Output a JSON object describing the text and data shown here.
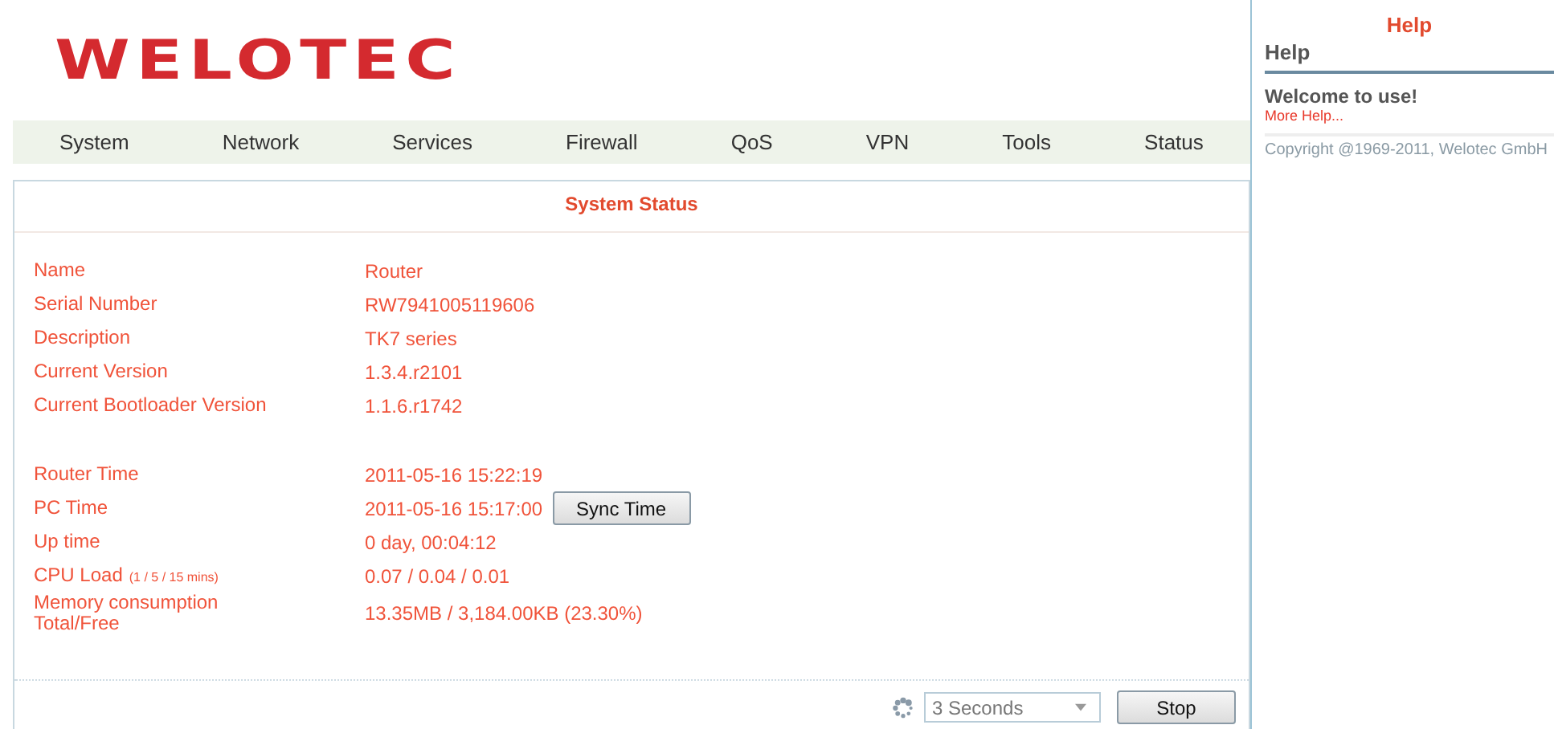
{
  "logo": {
    "text": "WELOTEC"
  },
  "nav": [
    {
      "label": "System"
    },
    {
      "label": "Network"
    },
    {
      "label": "Services"
    },
    {
      "label": "Firewall"
    },
    {
      "label": "QoS"
    },
    {
      "label": "VPN"
    },
    {
      "label": "Tools"
    },
    {
      "label": "Status"
    }
  ],
  "panel": {
    "title": "System Status",
    "rows": [
      {
        "kind": "info",
        "label": "Name",
        "value": "Router"
      },
      {
        "kind": "info",
        "label": "Serial Number",
        "value": "RW7941005119606"
      },
      {
        "kind": "info",
        "label": "Description",
        "value": "TK7 series"
      },
      {
        "kind": "info",
        "label": "Current Version",
        "value": "1.3.4.r2101"
      },
      {
        "kind": "info",
        "label": "Current Bootloader Version",
        "value": "1.1.6.r1742"
      },
      {
        "kind": "gap"
      },
      {
        "kind": "info",
        "label": "Router Time",
        "value": "2011-05-16 15:22:19"
      },
      {
        "kind": "button",
        "label": "PC Time",
        "value": "2011-05-16 15:17:00",
        "button": "Sync Time"
      },
      {
        "kind": "info",
        "label": "Up time",
        "value": "0 day, 00:04:12"
      },
      {
        "kind": "info",
        "label": "CPU Load",
        "note": "(1 / 5 / 15 mins)",
        "value": "0.07 / 0.04 / 0.01"
      },
      {
        "kind": "info",
        "label": "Memory consumption\nTotal/Free",
        "value": "13.35MB / 3,184.00KB (23.30%)"
      }
    ],
    "refresh": {
      "interval": "3 Seconds",
      "button": "Stop"
    }
  },
  "help": {
    "heading": "Help",
    "title": "Help",
    "welcome": "Welcome to use!",
    "link": "More Help...",
    "copyright": "Copyright @1969-2011, Welotec GmbH"
  }
}
